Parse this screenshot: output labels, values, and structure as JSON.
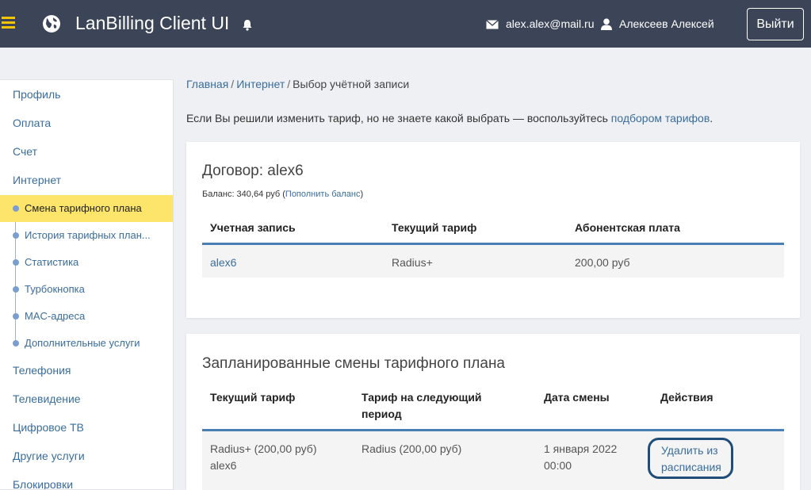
{
  "header": {
    "app_title": "LanBilling Client UI",
    "email": "alex.alex@mail.ru",
    "username": "Алексеев Алексей",
    "logout_label": "Выйти",
    "colors": {
      "bar": "#3c4558",
      "burger": "#f5c400"
    },
    "icons": [
      "menu-icon",
      "globe-icon",
      "bell-icon",
      "mail-icon",
      "user-icon"
    ]
  },
  "sidebar": {
    "items": [
      {
        "label": "Профиль"
      },
      {
        "label": "Оплата"
      },
      {
        "label": "Счет"
      },
      {
        "label": "Интернет"
      }
    ],
    "sub_items": [
      {
        "label": "Смена тарифного плана",
        "active": true
      },
      {
        "label": "История тарифных план..."
      },
      {
        "label": "Статистика"
      },
      {
        "label": "Турбокнопка"
      },
      {
        "label": "MAC-адреса"
      },
      {
        "label": "Дополнительные услуги"
      }
    ],
    "items_after": [
      {
        "label": "Телефония"
      },
      {
        "label": "Телевидение"
      },
      {
        "label": "Цифровое ТВ"
      },
      {
        "label": "Другие услуги"
      },
      {
        "label": "Блокировки"
      }
    ],
    "active_color": "#fde46b"
  },
  "breadcrumb": {
    "home": "Главная",
    "section": "Интернет",
    "current": "Выбор учётной записи",
    "separator": "/"
  },
  "hint": {
    "text": "Если Вы решили изменить тариф, но не знаете какой выбрать — воспользуйтесь ",
    "link": "подбором тарифов",
    "end": "."
  },
  "contract": {
    "title": "Договор: alex6",
    "balance_text": "Баланс: 340,64  руб (",
    "balance_link": "Пополнить баланс",
    "balance_end": ")",
    "columns": [
      "Учетная запись",
      "Текущий тариф",
      "Абонентская плата"
    ],
    "rows": [
      {
        "account": "alex6",
        "tariff": "Radius+",
        "fee": "200,00 руб"
      }
    ]
  },
  "scheduled": {
    "title": "Запланированные смены тарифного плана",
    "columns": [
      "Текущий тариф",
      "Тариф на следующий",
      "период",
      "Дата смены",
      "Действия"
    ],
    "rows": [
      {
        "current_line1": "Radius+ (200,00  руб)",
        "current_line2": "alex6",
        "next": "Radius (200,00  руб)",
        "date_line1": "1 января 2022",
        "date_line2": "00:00",
        "action_line1": "Удалить из",
        "action_line2": "расписания"
      }
    ]
  }
}
